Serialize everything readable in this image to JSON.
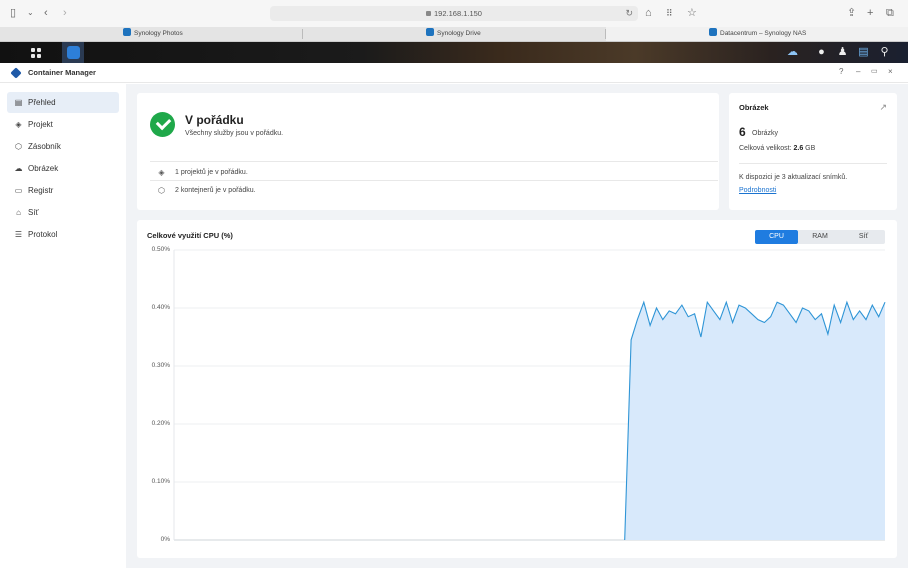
{
  "browser": {
    "url": "192.168.1.150",
    "tabs": [
      "Synology Photos",
      "Synology Drive",
      "Datacentrum – Synology NAS"
    ]
  },
  "window": {
    "title": "Container Manager",
    "controls": [
      "?",
      "–",
      "▭",
      "×"
    ]
  },
  "sidebar": {
    "items": [
      {
        "label": "Přehled",
        "icon": "overview-icon"
      },
      {
        "label": "Projekt",
        "icon": "layers-icon"
      },
      {
        "label": "Zásobník",
        "icon": "container-icon"
      },
      {
        "label": "Obrázek",
        "icon": "cloud-icon"
      },
      {
        "label": "Registr",
        "icon": "registry-icon"
      },
      {
        "label": "Síť",
        "icon": "network-icon"
      },
      {
        "label": "Protokol",
        "icon": "log-icon"
      }
    ]
  },
  "status": {
    "title": "V pořádku",
    "subtitle": "Všechny služby jsou v pořádku.",
    "rows": [
      "1 projektů je v pořádku.",
      "2 kontejnerů je v pořádku."
    ]
  },
  "images": {
    "title": "Obrázek",
    "count": "6",
    "count_label": "Obrázky",
    "size_label": "Celková velikost:",
    "size_value": "2.6",
    "size_unit": "GB",
    "update_text": "K dispozici je 3 aktualizací snímků.",
    "details_link": "Podrobnosti"
  },
  "chart": {
    "tabs": [
      "CPU",
      "RAM",
      "Síť"
    ],
    "active_tab": "CPU",
    "accent_color": "#1f7ce0",
    "line_color": "#2f95d6",
    "fill_color": "#d8e9fb"
  },
  "chart_data": {
    "type": "area",
    "title": "Celkové využití CPU (%)",
    "y_tick_labels": [
      "0.50%",
      "0.40%",
      "0.30%",
      "0.20%",
      "0.10%",
      "0%"
    ],
    "ylim": [
      0,
      0.5
    ],
    "grid": true,
    "series": [
      {
        "values": [
          0,
          0,
          0,
          0,
          0,
          0,
          0,
          0,
          0,
          0,
          0,
          0,
          0,
          0,
          0,
          0,
          0,
          0,
          0,
          0,
          0,
          0,
          0,
          0,
          0,
          0,
          0,
          0,
          0,
          0,
          0,
          0,
          0,
          0,
          0,
          0,
          0,
          0,
          0,
          0,
          0,
          0,
          0,
          0,
          0,
          0,
          0,
          0,
          0,
          0,
          0,
          0,
          0,
          0,
          0,
          0,
          0,
          0,
          0,
          0,
          0,
          0,
          0,
          0,
          0,
          0,
          0,
          0,
          0,
          0,
          0,
          0,
          0.345,
          0.38,
          0.41,
          0.37,
          0.4,
          0.38,
          0.395,
          0.39,
          0.405,
          0.385,
          0.39,
          0.35,
          0.41,
          0.395,
          0.38,
          0.41,
          0.375,
          0.405,
          0.4,
          0.39,
          0.38,
          0.375,
          0.385,
          0.41,
          0.405,
          0.39,
          0.375,
          0.4,
          0.395,
          0.38,
          0.39,
          0.355,
          0.405,
          0.375,
          0.41,
          0.38,
          0.395,
          0.38,
          0.405,
          0.385,
          0.41
        ]
      }
    ]
  }
}
